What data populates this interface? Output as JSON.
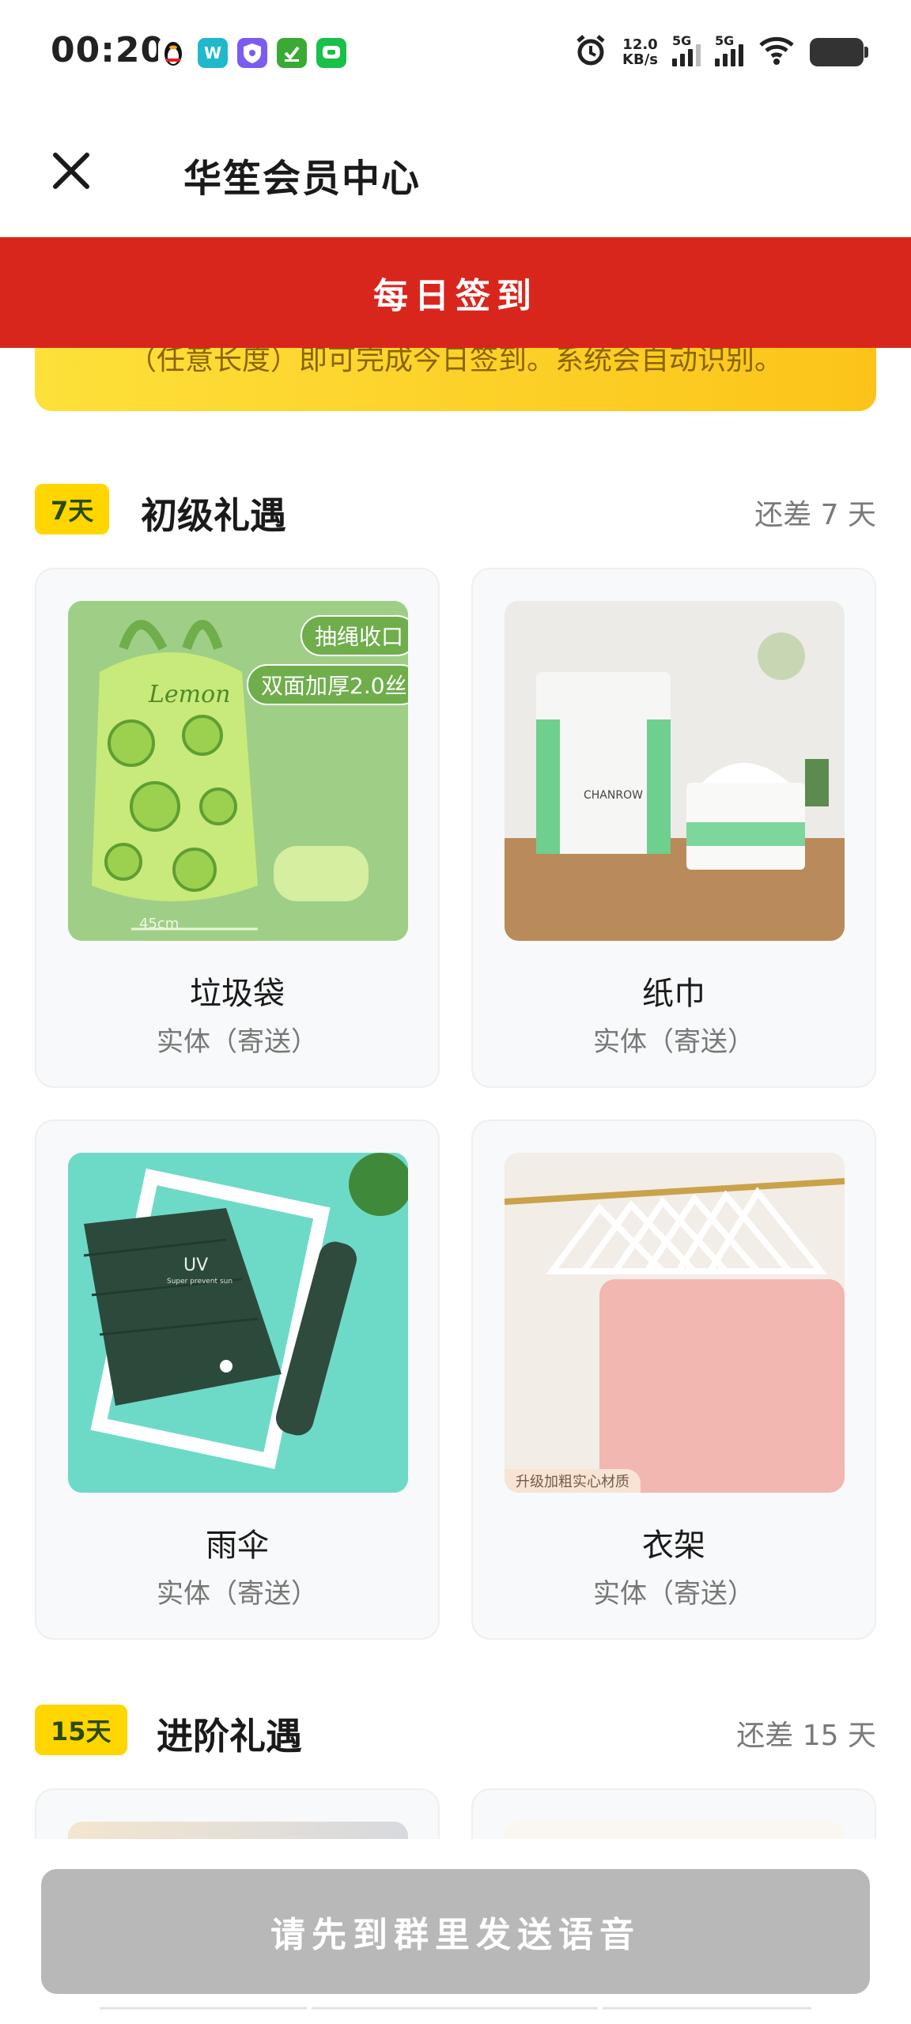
{
  "status_bar": {
    "time": "00:20",
    "net_speed_value": "12.0",
    "net_speed_unit": "KB/s",
    "signal_1": "5G",
    "signal_2": "5G"
  },
  "header": {
    "title": "华笙会员中心"
  },
  "banner": {
    "label": "每日签到"
  },
  "notice": {
    "text": "（任意长度）即可完成今日签到。系统会自动识别。"
  },
  "sections": [
    {
      "badge": "7天",
      "title": "初级礼遇",
      "remaining": "还差 7 天",
      "gifts": [
        {
          "name": "垃圾袋",
          "type": "实体（寄送）",
          "img_tag1": "抽绳收口",
          "img_tag2": "双面加厚2.0丝",
          "img_brand": "Lemon",
          "img_size": "45cm"
        },
        {
          "name": "纸巾",
          "type": "实体（寄送）",
          "img_brand": "CHANROW"
        },
        {
          "name": "雨伞",
          "type": "实体（寄送）",
          "img_brand": "UV",
          "img_sub": "Super prevent sun"
        },
        {
          "name": "衣架",
          "type": "实体（寄送）",
          "img_caption": "升级加粗实心材质"
        }
      ]
    },
    {
      "badge": "15天",
      "title": "进阶礼遇",
      "remaining": "还差 15 天"
    }
  ],
  "bottom": {
    "button_label": "请先到群里发送语音"
  },
  "colors": {
    "banner_red": "#d9261c",
    "badge_yellow": "#ffd600",
    "notice_yellow": "#fde03a",
    "button_disabled": "#b8b8b8"
  }
}
